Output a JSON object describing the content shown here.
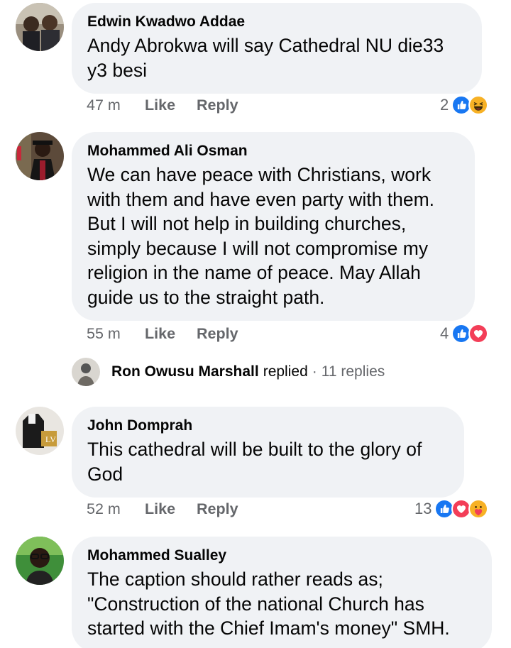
{
  "comments": [
    {
      "author": "Edwin Kwadwo Addae",
      "lines": [
        "Andy Abrokwa will say Cathedral NU die33",
        "y3 besi"
      ],
      "time": "47 m",
      "like_label": "Like",
      "reply_label": "Reply",
      "reaction_count": "2",
      "reactions": [
        "like-icon",
        "haha-icon"
      ]
    },
    {
      "author": "Mohammed Ali Osman",
      "lines": [
        "We can have peace with Christians, work",
        "with them and have even party with them.",
        "But I will not help in building churches,",
        "simply because I will not compromise my",
        "religion in the name of peace. May Allah",
        "guide us to the straight path."
      ],
      "time": "55 m",
      "like_label": "Like",
      "reply_label": "Reply",
      "reaction_count": "4",
      "reactions": [
        "like-icon",
        "love-icon"
      ],
      "reply_summary": {
        "name": "Ron Owusu Marshall",
        "verb": "replied",
        "separator": "·",
        "count": "11 replies"
      }
    },
    {
      "author": "John Domprah",
      "lines": [
        "This cathedral will be built to the glory of",
        "God"
      ],
      "time": "52 m",
      "like_label": "Like",
      "reply_label": "Reply",
      "reaction_count": "13",
      "reactions": [
        "like-icon",
        "love-icon",
        "care-icon"
      ]
    },
    {
      "author": "Mohammed Sualley",
      "lines": [
        "The caption should rather reads as;",
        "\"Construction of the national Church has",
        "started with the Chief Imam's money\" SMH."
      ]
    }
  ],
  "colors": {
    "bubble": "#f0f2f5",
    "meta": "#65676b",
    "like_blue": "#1877f2",
    "love_red": "#f33e58",
    "haha_yellow": "#f7b125"
  }
}
